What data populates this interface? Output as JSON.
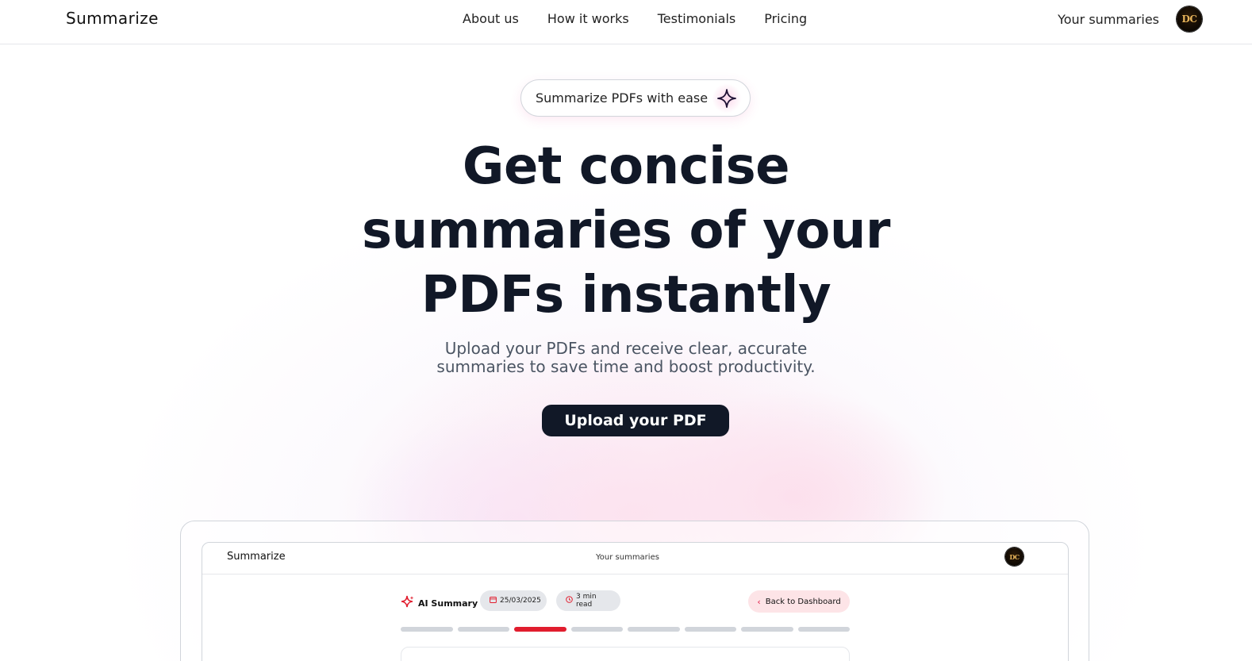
{
  "nav": {
    "brand": "Summarize",
    "links": [
      "About us",
      "How it works",
      "Testimonials",
      "Pricing"
    ],
    "your_summaries": "Your summaries",
    "avatar_initials": "DC"
  },
  "hero": {
    "badge": "Summarize PDFs with ease",
    "headline_line1": "Get concise",
    "headline_line2": "summaries of your",
    "headline_line3": "PDFs instantly",
    "subhead_line1": "Upload your PDFs and receive clear, accurate",
    "subhead_line2": "summaries to save time and boost productivity.",
    "cta": "Upload your PDF"
  },
  "preview": {
    "brand": "Summarize",
    "link": "Your summaries",
    "avatar_initials": "DC",
    "ai_label": "AI Summary",
    "date": "25/03/2025",
    "read_time": "3 min read",
    "back_button": "Back to Dashboard",
    "progress_segments": 8,
    "progress_active_index": 2
  },
  "colors": {
    "primary_dark": "#111827",
    "accent_red": "#e11d2e",
    "accent_pink": "#fde4e7"
  }
}
